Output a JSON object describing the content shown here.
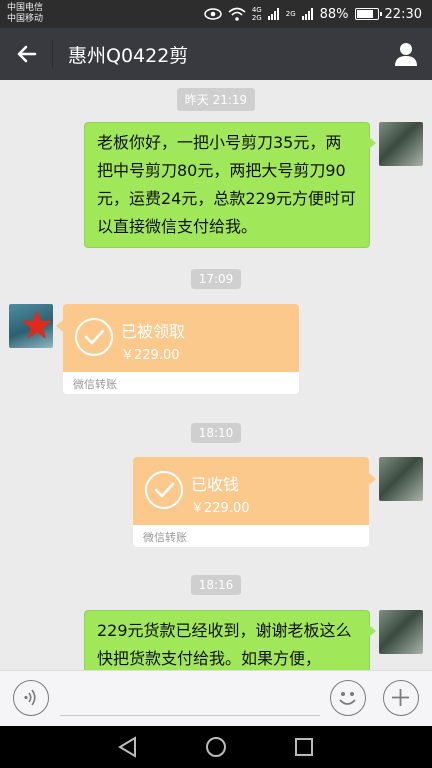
{
  "status_bar": {
    "carrier1": "中国电信",
    "carrier2": "中国移动",
    "net1_top": "4G",
    "net1_bottom": "2G",
    "net2": "2G",
    "battery_percent": "88%",
    "battery_level": 0.88,
    "time": "22:30"
  },
  "header": {
    "title": "惠州Q0422剪"
  },
  "chat": {
    "timestamps": [
      "昨天 21:19",
      "17:09",
      "18:10",
      "18:16"
    ],
    "msg1": "老板你好，一把小号剪刀35元，两把中号剪刀80元，两把大号剪刀90元，运费24元，总款229元方便时可以直接微信支付给我。",
    "transfer1": {
      "status": "已被领取",
      "amount": "￥229.00",
      "label": "微信转账"
    },
    "transfer2": {
      "status": "已收钱",
      "amount": "￥229.00",
      "label": "微信转账"
    },
    "msg4": "229元货款已经收到，谢谢老板这么快把货款支付给我。如果方便，"
  },
  "colors": {
    "bubble_green": "#a0e75a",
    "transfer_orange": "#fcc98c",
    "title_bar": "#393a3f"
  },
  "icons": {
    "back": "arrow-left-icon",
    "profile": "person-icon",
    "voice": "voice-icon",
    "emoji": "emoji-icon",
    "more": "plus-icon"
  }
}
